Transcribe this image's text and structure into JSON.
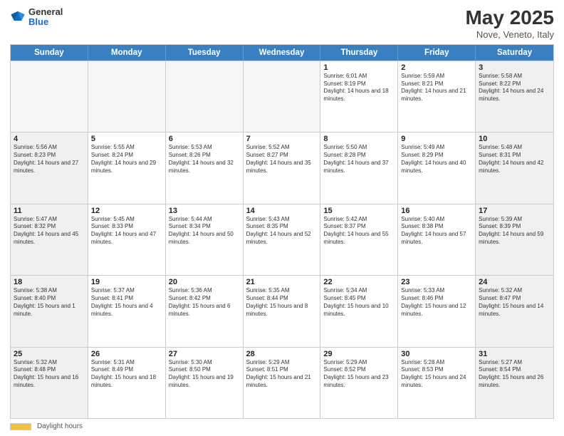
{
  "header": {
    "logo_general": "General",
    "logo_blue": "Blue",
    "title": "May 2025",
    "subtitle": "Nove, Veneto, Italy"
  },
  "calendar": {
    "days_of_week": [
      "Sunday",
      "Monday",
      "Tuesday",
      "Wednesday",
      "Thursday",
      "Friday",
      "Saturday"
    ],
    "rows": [
      [
        {
          "day": "",
          "empty": true
        },
        {
          "day": "",
          "empty": true
        },
        {
          "day": "",
          "empty": true
        },
        {
          "day": "",
          "empty": true
        },
        {
          "day": "1",
          "sunrise": "6:01 AM",
          "sunset": "8:19 PM",
          "daylight": "14 hours and 18 minutes."
        },
        {
          "day": "2",
          "sunrise": "5:59 AM",
          "sunset": "8:21 PM",
          "daylight": "14 hours and 21 minutes."
        },
        {
          "day": "3",
          "sunrise": "5:58 AM",
          "sunset": "8:22 PM",
          "daylight": "14 hours and 24 minutes."
        }
      ],
      [
        {
          "day": "4",
          "sunrise": "5:56 AM",
          "sunset": "8:23 PM",
          "daylight": "14 hours and 27 minutes."
        },
        {
          "day": "5",
          "sunrise": "5:55 AM",
          "sunset": "8:24 PM",
          "daylight": "14 hours and 29 minutes."
        },
        {
          "day": "6",
          "sunrise": "5:53 AM",
          "sunset": "8:26 PM",
          "daylight": "14 hours and 32 minutes."
        },
        {
          "day": "7",
          "sunrise": "5:52 AM",
          "sunset": "8:27 PM",
          "daylight": "14 hours and 35 minutes."
        },
        {
          "day": "8",
          "sunrise": "5:50 AM",
          "sunset": "8:28 PM",
          "daylight": "14 hours and 37 minutes."
        },
        {
          "day": "9",
          "sunrise": "5:49 AM",
          "sunset": "8:29 PM",
          "daylight": "14 hours and 40 minutes."
        },
        {
          "day": "10",
          "sunrise": "5:48 AM",
          "sunset": "8:31 PM",
          "daylight": "14 hours and 42 minutes."
        }
      ],
      [
        {
          "day": "11",
          "sunrise": "5:47 AM",
          "sunset": "8:32 PM",
          "daylight": "14 hours and 45 minutes."
        },
        {
          "day": "12",
          "sunrise": "5:45 AM",
          "sunset": "8:33 PM",
          "daylight": "14 hours and 47 minutes."
        },
        {
          "day": "13",
          "sunrise": "5:44 AM",
          "sunset": "8:34 PM",
          "daylight": "14 hours and 50 minutes."
        },
        {
          "day": "14",
          "sunrise": "5:43 AM",
          "sunset": "8:35 PM",
          "daylight": "14 hours and 52 minutes."
        },
        {
          "day": "15",
          "sunrise": "5:42 AM",
          "sunset": "8:37 PM",
          "daylight": "14 hours and 55 minutes."
        },
        {
          "day": "16",
          "sunrise": "5:40 AM",
          "sunset": "8:38 PM",
          "daylight": "14 hours and 57 minutes."
        },
        {
          "day": "17",
          "sunrise": "5:39 AM",
          "sunset": "8:39 PM",
          "daylight": "14 hours and 59 minutes."
        }
      ],
      [
        {
          "day": "18",
          "sunrise": "5:38 AM",
          "sunset": "8:40 PM",
          "daylight": "15 hours and 1 minute."
        },
        {
          "day": "19",
          "sunrise": "5:37 AM",
          "sunset": "8:41 PM",
          "daylight": "15 hours and 4 minutes."
        },
        {
          "day": "20",
          "sunrise": "5:36 AM",
          "sunset": "8:42 PM",
          "daylight": "15 hours and 6 minutes."
        },
        {
          "day": "21",
          "sunrise": "5:35 AM",
          "sunset": "8:44 PM",
          "daylight": "15 hours and 8 minutes."
        },
        {
          "day": "22",
          "sunrise": "5:34 AM",
          "sunset": "8:45 PM",
          "daylight": "15 hours and 10 minutes."
        },
        {
          "day": "23",
          "sunrise": "5:33 AM",
          "sunset": "8:46 PM",
          "daylight": "15 hours and 12 minutes."
        },
        {
          "day": "24",
          "sunrise": "5:32 AM",
          "sunset": "8:47 PM",
          "daylight": "15 hours and 14 minutes."
        }
      ],
      [
        {
          "day": "25",
          "sunrise": "5:32 AM",
          "sunset": "8:48 PM",
          "daylight": "15 hours and 16 minutes."
        },
        {
          "day": "26",
          "sunrise": "5:31 AM",
          "sunset": "8:49 PM",
          "daylight": "15 hours and 18 minutes."
        },
        {
          "day": "27",
          "sunrise": "5:30 AM",
          "sunset": "8:50 PM",
          "daylight": "15 hours and 19 minutes."
        },
        {
          "day": "28",
          "sunrise": "5:29 AM",
          "sunset": "8:51 PM",
          "daylight": "15 hours and 21 minutes."
        },
        {
          "day": "29",
          "sunrise": "5:29 AM",
          "sunset": "8:52 PM",
          "daylight": "15 hours and 23 minutes."
        },
        {
          "day": "30",
          "sunrise": "5:28 AM",
          "sunset": "8:53 PM",
          "daylight": "15 hours and 24 minutes."
        },
        {
          "day": "31",
          "sunrise": "5:27 AM",
          "sunset": "8:54 PM",
          "daylight": "15 hours and 26 minutes."
        }
      ]
    ]
  },
  "footer": {
    "daylight_label": "Daylight hours"
  },
  "labels": {
    "sunrise": "Sunrise: ",
    "sunset": "Sunset: ",
    "daylight": "Daylight: "
  }
}
